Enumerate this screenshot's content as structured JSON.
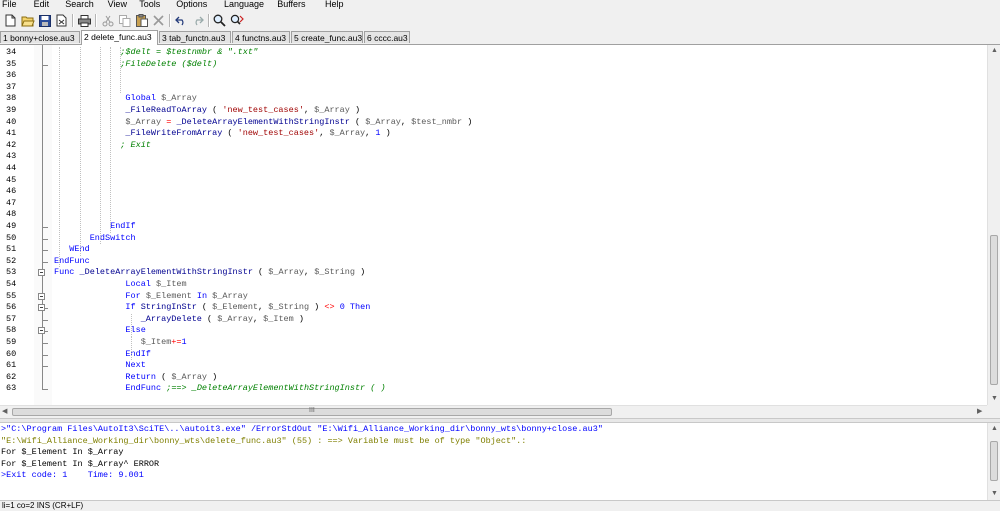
{
  "menu": [
    "File",
    "Edit",
    "Search",
    "View",
    "Tools",
    "Options",
    "Language",
    "Buffers",
    "Help"
  ],
  "toolbar_icons": [
    "new-file-icon",
    "open-folder-icon",
    "save-icon",
    "close-file-icon",
    "print-icon",
    "cut-icon",
    "copy-icon",
    "paste-icon",
    "delete-icon",
    "undo-icon",
    "redo-icon",
    "find-icon",
    "replace-icon"
  ],
  "tabs": [
    {
      "label": "1 bonny+close.au3",
      "active": false
    },
    {
      "label": "2 delete_func.au3",
      "active": true
    },
    {
      "label": "3 tab_functn.au3",
      "active": false
    },
    {
      "label": "4 functns.au3",
      "active": false
    },
    {
      "label": "5 create_func.au3",
      "active": false
    },
    {
      "label": "6 cccc.au3",
      "active": false
    }
  ],
  "editor": {
    "lines": [
      {
        "n": "34",
        "indent": 13,
        "t": [
          [
            "cmt",
            ";$delt = $testnmbr & \".txt\""
          ]
        ]
      },
      {
        "n": "35",
        "indent": 13,
        "t": [
          [
            "cmt",
            ";FileDelete ($delt)"
          ]
        ]
      },
      {
        "n": "36",
        "indent": 0,
        "t": []
      },
      {
        "n": "37",
        "indent": 0,
        "t": []
      },
      {
        "n": "38",
        "indent": 14,
        "t": [
          [
            "kw",
            "Global"
          ],
          [
            "plain",
            " "
          ],
          [
            "var",
            "$_Array"
          ]
        ]
      },
      {
        "n": "39",
        "indent": 14,
        "t": [
          [
            "fn",
            "_FileReadToArray"
          ],
          [
            "plain",
            " ( "
          ],
          [
            "str",
            "'new_test_cases'"
          ],
          [
            "plain",
            ", "
          ],
          [
            "var",
            "$_Array"
          ],
          [
            "plain",
            " )"
          ]
        ]
      },
      {
        "n": "40",
        "indent": 14,
        "t": [
          [
            "var",
            "$_Array"
          ],
          [
            "plain",
            " "
          ],
          [
            "op",
            "="
          ],
          [
            "plain",
            " "
          ],
          [
            "fn",
            "_DeleteArrayElementWithStringInstr"
          ],
          [
            "plain",
            " ( "
          ],
          [
            "var",
            "$_Array"
          ],
          [
            "plain",
            ", "
          ],
          [
            "var",
            "$test_nmbr"
          ],
          [
            "plain",
            " )"
          ]
        ]
      },
      {
        "n": "41",
        "indent": 14,
        "t": [
          [
            "fn",
            "_FileWriteFromArray"
          ],
          [
            "plain",
            " ( "
          ],
          [
            "str",
            "'new_test_cases'"
          ],
          [
            "plain",
            ", "
          ],
          [
            "var",
            "$_Array"
          ],
          [
            "plain",
            ", "
          ],
          [
            "num",
            "1"
          ],
          [
            "plain",
            " )"
          ]
        ]
      },
      {
        "n": "42",
        "indent": 13,
        "t": [
          [
            "cmt",
            "; Exit"
          ]
        ]
      },
      {
        "n": "43",
        "indent": 0,
        "t": []
      },
      {
        "n": "44",
        "indent": 0,
        "t": []
      },
      {
        "n": "45",
        "indent": 0,
        "t": []
      },
      {
        "n": "46",
        "indent": 0,
        "t": []
      },
      {
        "n": "47",
        "indent": 0,
        "t": []
      },
      {
        "n": "48",
        "indent": 0,
        "t": []
      },
      {
        "n": "49",
        "indent": 11,
        "t": [
          [
            "kw",
            "EndIf"
          ]
        ]
      },
      {
        "n": "50",
        "indent": 7,
        "t": [
          [
            "kw",
            "EndSwitch"
          ]
        ]
      },
      {
        "n": "51",
        "indent": 3,
        "t": [
          [
            "kw",
            "WEnd"
          ]
        ]
      },
      {
        "n": "52",
        "indent": 0,
        "t": [
          [
            "kw",
            "EndFunc"
          ]
        ]
      },
      {
        "n": "53",
        "indent": 0,
        "t": [
          [
            "kw",
            "Func"
          ],
          [
            "plain",
            " "
          ],
          [
            "fn",
            "_DeleteArrayElementWithStringInstr"
          ],
          [
            "plain",
            " ( "
          ],
          [
            "var",
            "$_Array"
          ],
          [
            "plain",
            ", "
          ],
          [
            "var",
            "$_String"
          ],
          [
            "plain",
            " )"
          ]
        ]
      },
      {
        "n": "54",
        "indent": 14,
        "t": [
          [
            "kw",
            "Local"
          ],
          [
            "plain",
            " "
          ],
          [
            "var",
            "$_Item"
          ]
        ]
      },
      {
        "n": "55",
        "indent": 14,
        "t": [
          [
            "kw",
            "For"
          ],
          [
            "plain",
            " "
          ],
          [
            "var",
            "$_Element"
          ],
          [
            "plain",
            " "
          ],
          [
            "kw",
            "In"
          ],
          [
            "plain",
            " "
          ],
          [
            "var",
            "$_Array"
          ]
        ]
      },
      {
        "n": "56",
        "indent": 14,
        "t": [
          [
            "kw",
            "If"
          ],
          [
            "plain",
            " "
          ],
          [
            "fn",
            "StringInStr"
          ],
          [
            "plain",
            " ( "
          ],
          [
            "var",
            "$_Element"
          ],
          [
            "plain",
            ", "
          ],
          [
            "var",
            "$_String"
          ],
          [
            "plain",
            " ) "
          ],
          [
            "op",
            "<>"
          ],
          [
            "plain",
            " "
          ],
          [
            "num",
            "0"
          ],
          [
            "plain",
            " "
          ],
          [
            "kw",
            "Then"
          ]
        ]
      },
      {
        "n": "57",
        "indent": 17,
        "t": [
          [
            "fn",
            "_ArrayDelete"
          ],
          [
            "plain",
            " ( "
          ],
          [
            "var",
            "$_Array"
          ],
          [
            "plain",
            ", "
          ],
          [
            "var",
            "$_Item"
          ],
          [
            "plain",
            " )"
          ]
        ]
      },
      {
        "n": "58",
        "indent": 14,
        "t": [
          [
            "kw",
            "Else"
          ]
        ]
      },
      {
        "n": "59",
        "indent": 17,
        "t": [
          [
            "var",
            "$_Item"
          ],
          [
            "op",
            "+="
          ],
          [
            "num",
            "1"
          ]
        ]
      },
      {
        "n": "60",
        "indent": 14,
        "t": [
          [
            "kw",
            "EndIf"
          ]
        ]
      },
      {
        "n": "61",
        "indent": 14,
        "t": [
          [
            "kw",
            "Next"
          ]
        ]
      },
      {
        "n": "62",
        "indent": 14,
        "t": [
          [
            "kw",
            "Return"
          ],
          [
            "plain",
            " ( "
          ],
          [
            "var",
            "$_Array"
          ],
          [
            "plain",
            " )"
          ]
        ]
      },
      {
        "n": "63",
        "indent": 14,
        "t": [
          [
            "kw",
            "EndFunc"
          ],
          [
            "plain",
            " "
          ],
          [
            "cmt",
            ";==> _DeleteArrayElementWithStringInstr ( )"
          ]
        ]
      }
    ]
  },
  "hscroll_grip": "III",
  "output": [
    {
      "cls": "cmd",
      "text": ">\"C:\\Program Files\\AutoIt3\\SciTE\\..\\autoit3.exe\" /ErrorStdOut \"E:\\Wifi_Alliance_Working_dir\\bonny_wts\\bonny+close.au3\""
    },
    {
      "cls": "err",
      "text": "\"E:\\Wifi_Alliance_Working_dir\\bonny_wts\\delete_func.au3\" (55) : ==> Variable must be of type \"Object\".:"
    },
    {
      "cls": "plain",
      "text": "For $_Element In $_Array"
    },
    {
      "cls": "plain",
      "text": "For $_Element In $_Array^ ERROR"
    },
    {
      "cls": "cmd",
      "text": ">Exit code: 1    Time: 9.001"
    }
  ],
  "status": "li=1 co=2 INS (CR+LF)"
}
